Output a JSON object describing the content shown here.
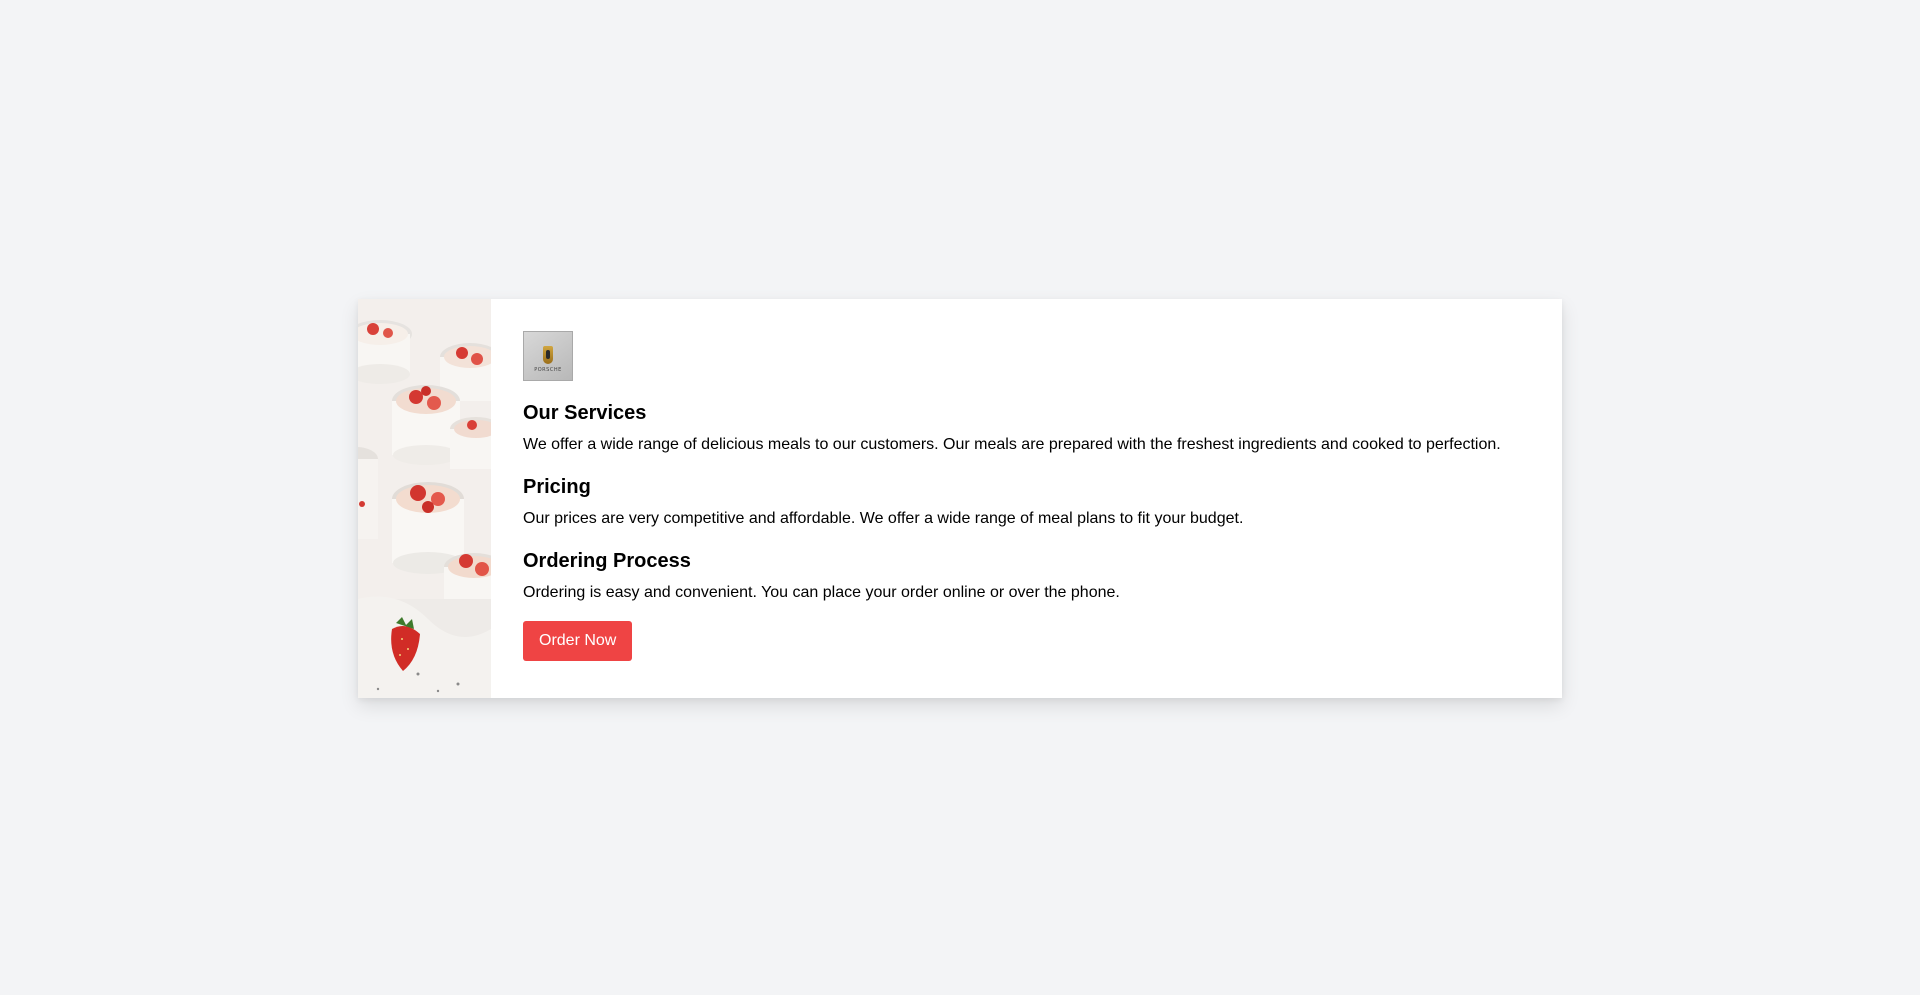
{
  "hero_image": {
    "icon": "dessert-jars-strawberries-image"
  },
  "logo": {
    "icon": "porsche-crest-logo",
    "text": "PORSCHE"
  },
  "sections": [
    {
      "title": "Our Services",
      "body": "We offer a wide range of delicious meals to our customers. Our meals are prepared with the freshest ingredients and cooked to perfection."
    },
    {
      "title": "Pricing",
      "body": "Our prices are very competitive and affordable. We offer a wide range of meal plans to fit your budget."
    },
    {
      "title": "Ordering Process",
      "body": "Ordering is easy and convenient. You can place your order online or over the phone."
    }
  ],
  "cta": {
    "label": "Order Now",
    "color": "#ef4444"
  },
  "colors": {
    "background": "#f3f4f6",
    "card": "#ffffff"
  }
}
